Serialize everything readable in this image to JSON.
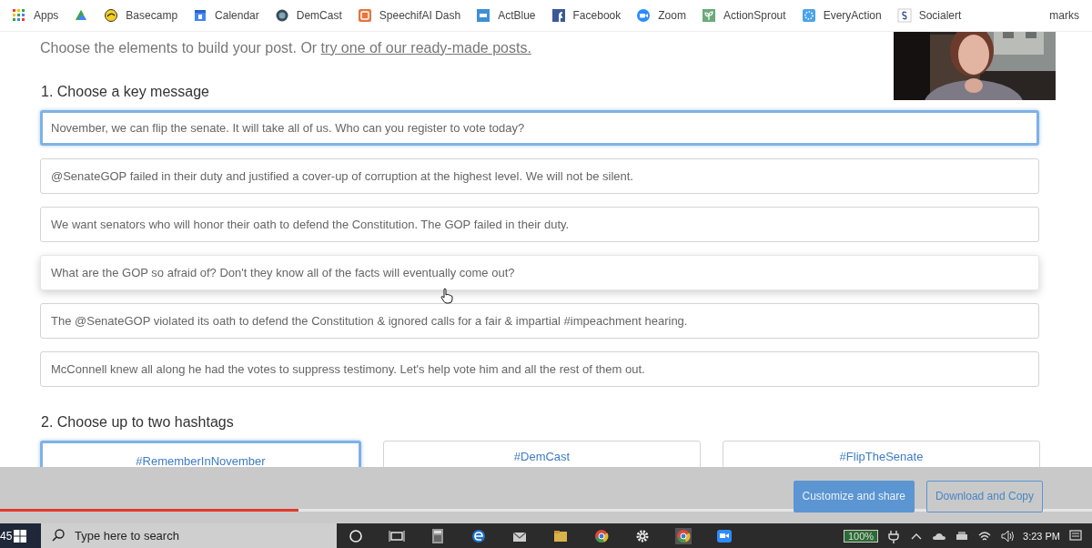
{
  "bookmarks": [
    {
      "kind": "labeled",
      "label": "Apps"
    },
    {
      "kind": "icon_only"
    },
    {
      "kind": "labeled",
      "label": "Basecamp"
    },
    {
      "kind": "labeled",
      "label": "Calendar"
    },
    {
      "kind": "labeled",
      "label": "DemCast"
    },
    {
      "kind": "labeled",
      "label": "SpeechifAI Dash"
    },
    {
      "kind": "labeled",
      "label": "ActBlue"
    },
    {
      "kind": "labeled",
      "label": "Facebook"
    },
    {
      "kind": "labeled",
      "label": "Zoom"
    },
    {
      "kind": "labeled",
      "label": "ActionSprout"
    },
    {
      "kind": "labeled",
      "label": "EveryAction"
    },
    {
      "kind": "labeled",
      "label": "Socialert"
    }
  ],
  "bookmarks_overflow": "marks",
  "intro": {
    "text": "Choose the elements to build your post. Or ",
    "link": "try one of our ready-made posts."
  },
  "sections": [
    {
      "title": "1. Choose a key message",
      "kind": "list",
      "items": [
        {
          "text": "November, we can flip the senate. It will take all of us. Who can you register to vote today?",
          "selected": true,
          "hovered": false
        },
        {
          "text": "@SenateGOP failed in their duty and justified a cover-up of corruption at the highest level. We will not be silent.",
          "selected": false,
          "hovered": false
        },
        {
          "text": "We want senators who will honor their oath to defend the Constitution. The GOP failed in their duty.",
          "selected": false,
          "hovered": false
        },
        {
          "text": "What are the GOP so afraid of? Don't they know all of the facts will eventually come out?",
          "selected": false,
          "hovered": true
        },
        {
          "text": "The @SenateGOP violated its oath to defend the Constitution & ignored calls for a fair & impartial #impeachment hearing.",
          "selected": false,
          "hovered": false
        },
        {
          "text": "McConnell knew all along he had the votes to suppress testimony. Let's help vote him and all the rest of them out.",
          "selected": false,
          "hovered": false
        }
      ]
    },
    {
      "title": "2. Choose up to two hashtags",
      "kind": "grid",
      "items": [
        {
          "text": "#RememberInNovember",
          "selected": true,
          "hovered": false
        },
        {
          "text": "#DemCast",
          "selected": false,
          "hovered": false
        },
        {
          "text": "#FlipTheSenate",
          "selected": false,
          "hovered": false
        }
      ]
    }
  ],
  "actions": [
    {
      "label": "Customize and share",
      "kind": "primary"
    },
    {
      "label": "Download and Copy",
      "kind": "outline"
    }
  ],
  "video_progress": {
    "level": 0.273
  },
  "taskbar": {
    "clock_fragment": "45",
    "search_placeholder": "Type here to search",
    "battery": "100%",
    "time": "3:23 PM"
  }
}
